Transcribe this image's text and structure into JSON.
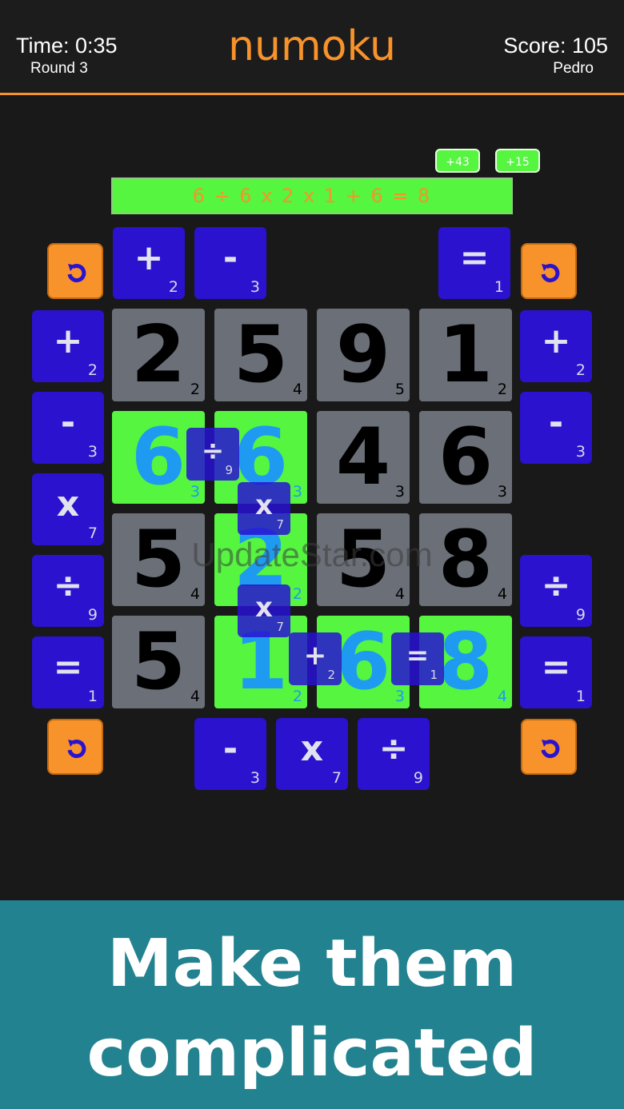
{
  "header": {
    "time": "Time: 0:35",
    "round": "Round 3",
    "title": "numoku",
    "score": "Score: 105",
    "player": "Pedro"
  },
  "badges": [
    "+43",
    "+15"
  ],
  "equation": "6 ÷ 6 x 2 x 1 + 6 = 8",
  "top_ops": [
    {
      "sym": "+",
      "count": "2"
    },
    {
      "sym": "-",
      "count": "3"
    },
    {
      "sym": "=",
      "count": "1"
    }
  ],
  "left_ops": [
    {
      "sym": "+",
      "count": "2"
    },
    {
      "sym": "-",
      "count": "3"
    },
    {
      "sym": "x",
      "count": "7"
    },
    {
      "sym": "÷",
      "count": "9"
    },
    {
      "sym": "=",
      "count": "1"
    }
  ],
  "right_ops": [
    {
      "sym": "+",
      "count": "2"
    },
    {
      "sym": "-",
      "count": "3"
    },
    {
      "sym": "÷",
      "count": "9"
    },
    {
      "sym": "=",
      "count": "1"
    }
  ],
  "bottom_ops": [
    {
      "sym": "-",
      "count": "3"
    },
    {
      "sym": "x",
      "count": "7"
    },
    {
      "sym": "÷",
      "count": "9"
    }
  ],
  "grid": [
    [
      {
        "n": "2",
        "c": "2",
        "s": "grey"
      },
      {
        "n": "5",
        "c": "4",
        "s": "grey"
      },
      {
        "n": "9",
        "c": "5",
        "s": "grey"
      },
      {
        "n": "1",
        "c": "2",
        "s": "grey"
      }
    ],
    [
      {
        "n": "6",
        "c": "3",
        "s": "green"
      },
      {
        "n": "6",
        "c": "3",
        "s": "green"
      },
      {
        "n": "4",
        "c": "3",
        "s": "grey"
      },
      {
        "n": "6",
        "c": "3",
        "s": "grey"
      }
    ],
    [
      {
        "n": "5",
        "c": "4",
        "s": "grey"
      },
      {
        "n": "2",
        "c": "2",
        "s": "green"
      },
      {
        "n": "5",
        "c": "4",
        "s": "grey"
      },
      {
        "n": "8",
        "c": "4",
        "s": "grey"
      }
    ],
    [
      {
        "n": "5",
        "c": "4",
        "s": "grey"
      },
      {
        "n": "1",
        "c": "2",
        "s": "green"
      },
      {
        "n": "6",
        "c": "3",
        "s": "green"
      },
      {
        "n": "8",
        "c": "4",
        "s": "green"
      }
    ]
  ],
  "placed_ops": [
    {
      "sym": "÷",
      "count": "9"
    },
    {
      "sym": "x",
      "count": "7"
    },
    {
      "sym": "x",
      "count": "7"
    },
    {
      "sym": "+",
      "count": "2"
    },
    {
      "sym": "=",
      "count": "1"
    }
  ],
  "watermark": "UpdateStar.com",
  "tagline_line1": "Make them",
  "tagline_line2": "complicated"
}
